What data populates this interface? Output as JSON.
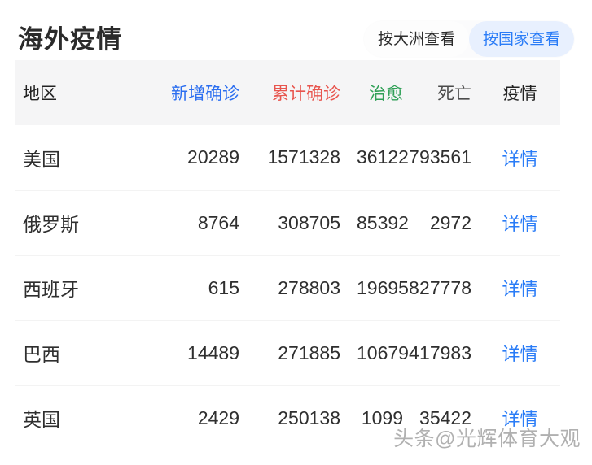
{
  "header": {
    "title": "海外疫情",
    "toggle": {
      "options": [
        {
          "label": "按大洲查看",
          "active": false
        },
        {
          "label": "按国家查看",
          "active": true
        }
      ]
    }
  },
  "table": {
    "columns": [
      {
        "key": "region",
        "label": "地区",
        "color": "#222222",
        "bg": "#f5f5f6"
      },
      {
        "key": "new_confirmed",
        "label": "新增确诊",
        "color": "#2b6ef0",
        "bg": "#dfe9f8"
      },
      {
        "key": "total_confirmed",
        "label": "累计确诊",
        "color": "#e8554e",
        "bg": "#fbe6e6"
      },
      {
        "key": "cured",
        "label": "治愈",
        "color": "#30a057",
        "bg": "#e2f3e7"
      },
      {
        "key": "deaths",
        "label": "死亡",
        "color": "#4b4b4b",
        "bg": "#f2f5f7"
      },
      {
        "key": "action",
        "label": "疫情",
        "color": "#222222",
        "bg": "#f5f5f6"
      }
    ],
    "rows": [
      {
        "region": "美国",
        "new_confirmed": "20289",
        "total_confirmed": "1571328",
        "cured": "361227",
        "deaths": "93561",
        "action": "详情"
      },
      {
        "region": "俄罗斯",
        "new_confirmed": "8764",
        "total_confirmed": "308705",
        "cured": "85392",
        "deaths": "2972",
        "action": "详情"
      },
      {
        "region": "西班牙",
        "new_confirmed": "615",
        "total_confirmed": "278803",
        "cured": "196958",
        "deaths": "27778",
        "action": "详情"
      },
      {
        "region": "巴西",
        "new_confirmed": "14489",
        "total_confirmed": "271885",
        "cured": "106794",
        "deaths": "17983",
        "action": "详情"
      },
      {
        "region": "英国",
        "new_confirmed": "2429",
        "total_confirmed": "250138",
        "cured": "1099",
        "deaths": "35422",
        "action": "详情"
      }
    ]
  },
  "watermark": {
    "text": "头条@光辉体育大观"
  }
}
